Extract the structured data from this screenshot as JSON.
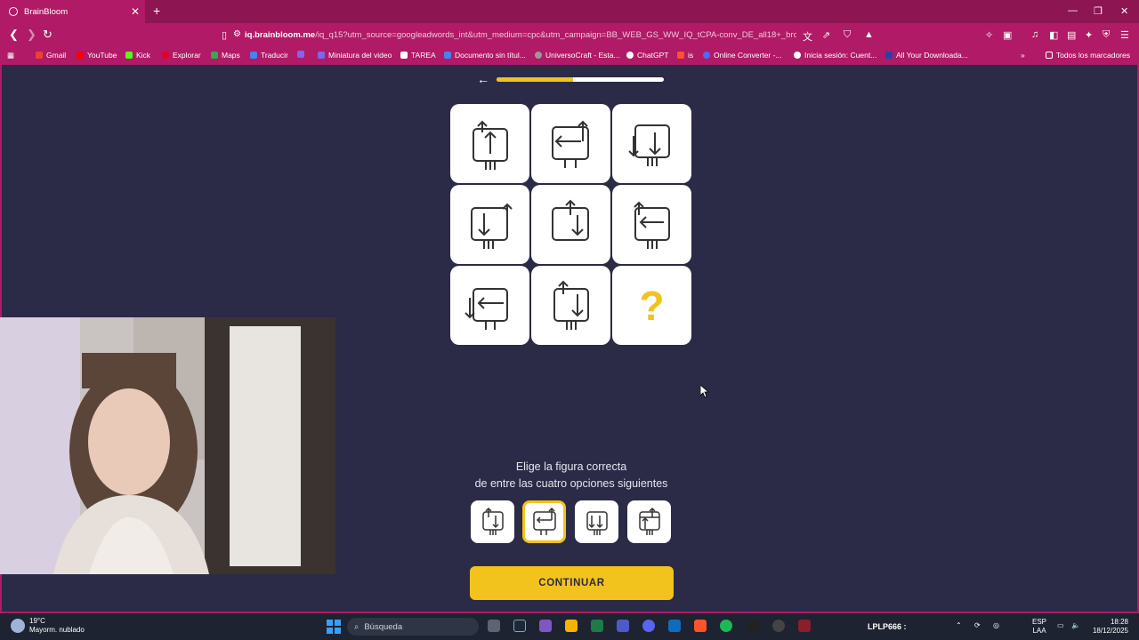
{
  "browser": {
    "tab_title": "BrainBloom",
    "url_domain": "iq.brainbloom.me",
    "url_rest": "/iq_q15?utm_source=googleadwords_int&utm_medium=cpc&utm_campaign=BB_WEB_GS_WW_IQ_tCPA-conv_DE_all18+_bro...",
    "bookmarks": [
      "Gmail",
      "YouTube",
      "Kick",
      "Explorar",
      "Maps",
      "Traducir",
      "",
      "Miniatura del video",
      "TAREA",
      "Documento sin títul...",
      "UniversoCraft - Esta...",
      "ChatGPT",
      "is",
      "Online Converter -...",
      "Inicia sesión: Cuent...",
      "All Your Downloada..."
    ],
    "bookmarks_all": "Todos los marcadores"
  },
  "quiz": {
    "progress_fraction": 0.46,
    "missing_mark": "?",
    "instruction_line1": "Elige la figura correcta",
    "instruction_line2": "de entre las cuatro opciones siguientes",
    "continue_label": "CONTINUAR",
    "selected_option": 2,
    "accent_color": "#f2c31c",
    "background_color": "#2b2a47"
  },
  "taskbar": {
    "temperature": "19°C",
    "weather": "Mayorm. nublado",
    "search_placeholder": "Búsqueda",
    "user_label": "LPLP666 :",
    "lang": "ESP",
    "lang_sub": "LAA",
    "time": "18:28",
    "date": "18/12/2025"
  }
}
